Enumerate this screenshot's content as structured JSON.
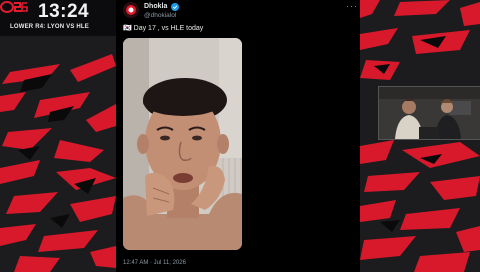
{
  "overlay": {
    "timer": "13:24",
    "match_label": "LOWER R4: LYON VS HLE",
    "accent_color": "#e21b2e",
    "logo_icon": "event-logo-icon"
  },
  "tweet": {
    "author": "Dhokla",
    "handle": "@dhokialol",
    "text": "🇰🇷 Day 17 , vs HLE today",
    "timestamp": "12:47 AM · Jul 11, 2026",
    "more_label": "···"
  }
}
